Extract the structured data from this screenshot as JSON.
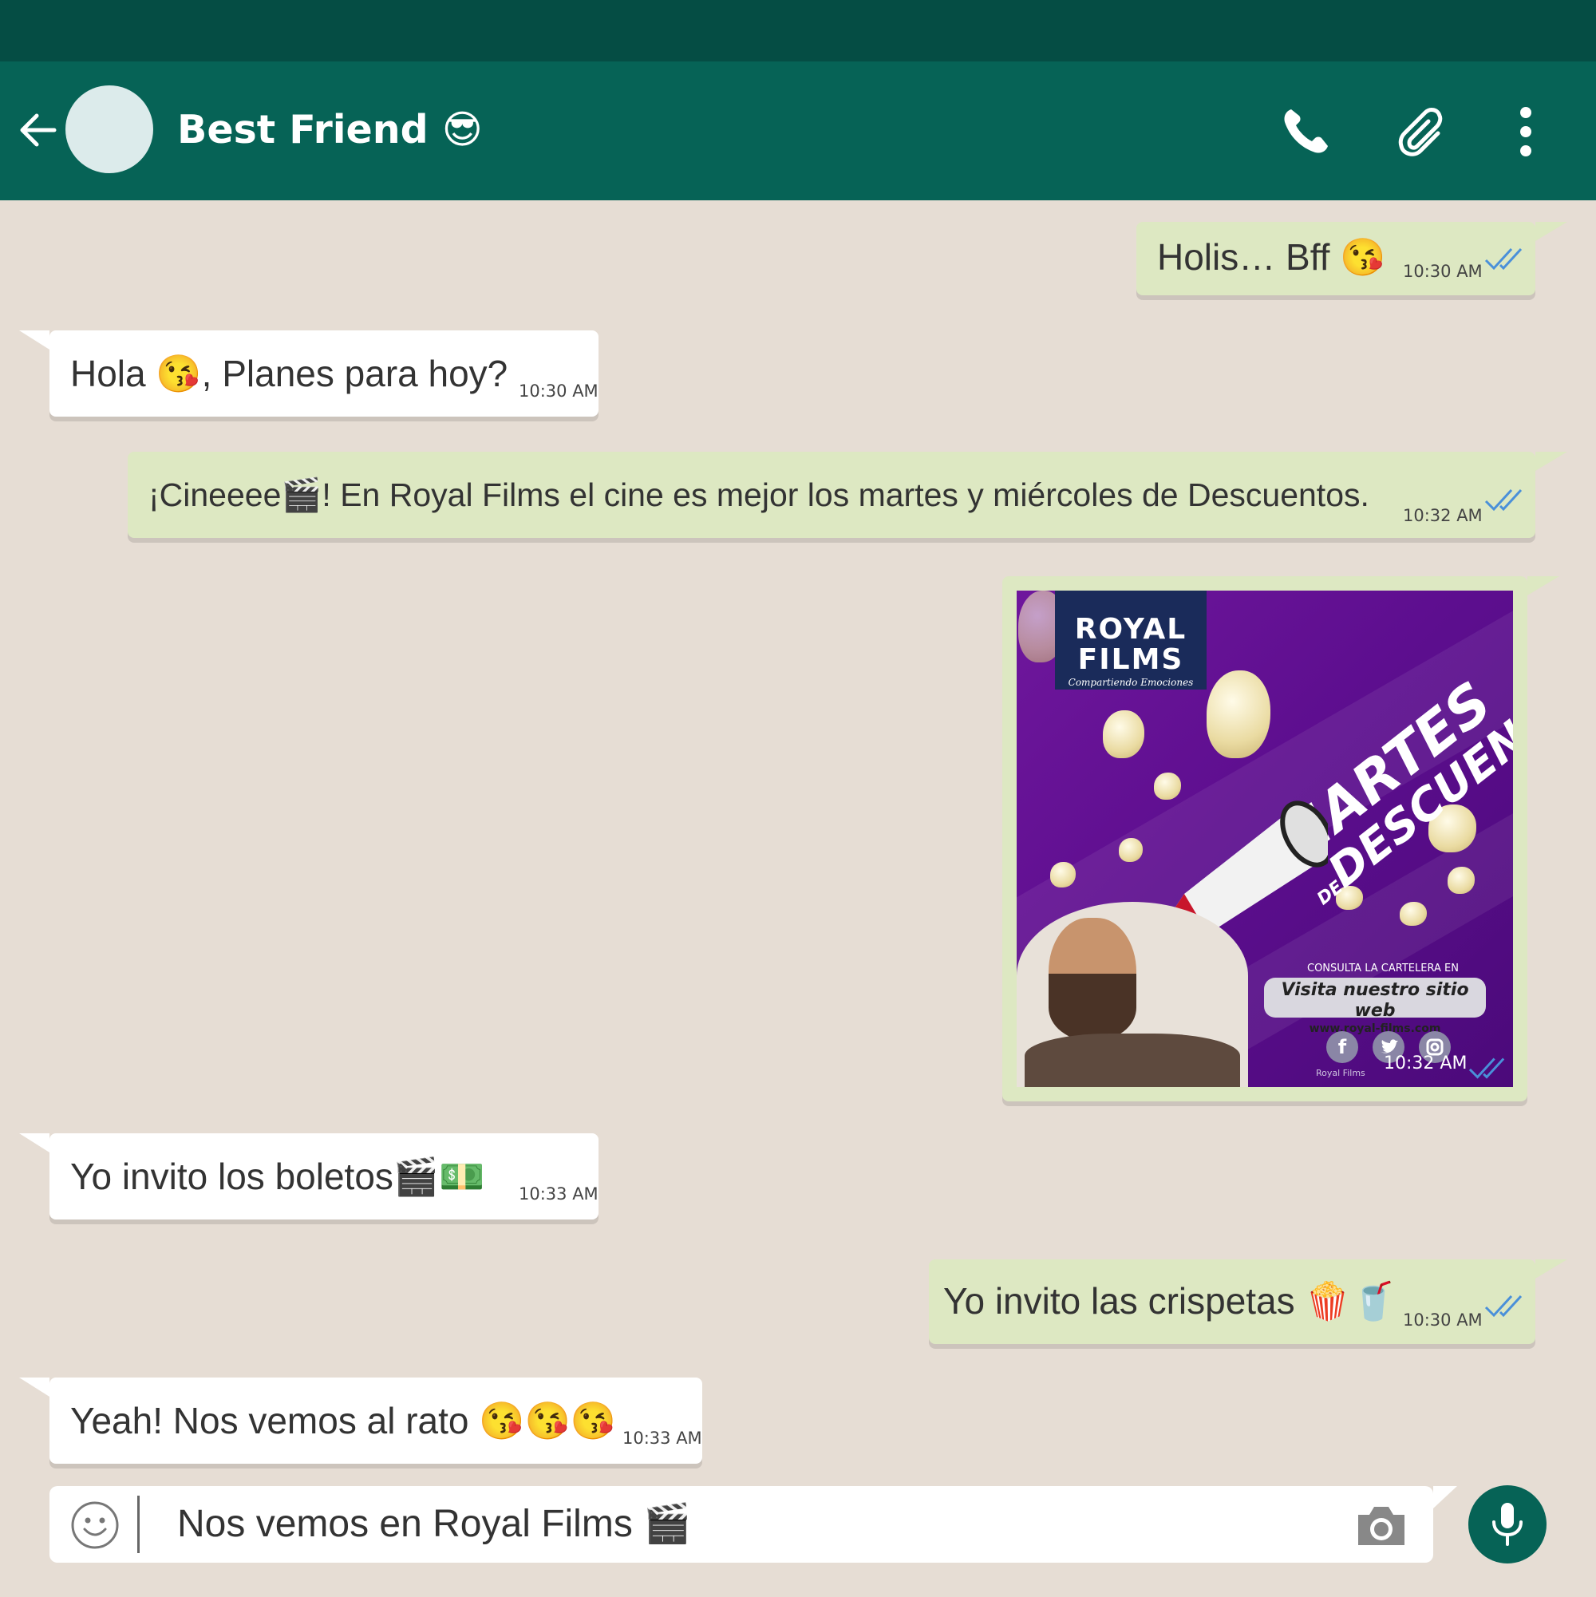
{
  "header": {
    "back_label": "←",
    "contact_name": "Best Friend 😎"
  },
  "messages": [
    {
      "direction": "outgoing",
      "text": "Holis… Bff 😘",
      "time": "10:30 AM",
      "status": "read"
    },
    {
      "direction": "incoming",
      "text": "Hola 😘, Planes para hoy?",
      "time": "10:30 AM"
    },
    {
      "direction": "outgoing",
      "text": "¡Cineeee🎬! En Royal Films el cine es mejor los martes y miércoles de Descuentos.",
      "time": "10:32 AM",
      "status": "read"
    },
    {
      "direction": "outgoing",
      "type": "image",
      "time": "10:32 AM",
      "status": "read"
    },
    {
      "direction": "incoming",
      "text": "Yo invito los boletos🎬💵",
      "time": "10:33 AM"
    },
    {
      "direction": "outgoing",
      "text": "Yo invito las crispetas 🍿🥤",
      "time": "10:30 AM",
      "status": "read"
    },
    {
      "direction": "incoming",
      "text": "Yeah! Nos vemos al rato 😘😘😘",
      "time": "10:33 AM"
    }
  ],
  "promo": {
    "logo_line1": "ROYAL",
    "logo_line2": "FILMS",
    "logo_tagline": "Compartiendo Emociones",
    "title_line1": "MARTES",
    "title_line2": "DESCUENTOS",
    "title_connector": "DE",
    "consulta": "CONSULTA LA CARTELERA EN",
    "site_label": "Visita nuestro sitio web",
    "site_url": "www.royal-films.com",
    "social_caption": "Royal Films",
    "social_icons": [
      "facebook-icon",
      "twitter-icon",
      "instagram-icon"
    ]
  },
  "composer": {
    "text": "Nos vemos en Royal Films 🎬"
  },
  "colors": {
    "header": "#066356",
    "statusbar": "#054d44",
    "background": "#e6ddd4",
    "outgoing_bubble": "#dde8c2",
    "incoming_bubble": "#ffffff",
    "read_ticks": "#4a90d9"
  }
}
